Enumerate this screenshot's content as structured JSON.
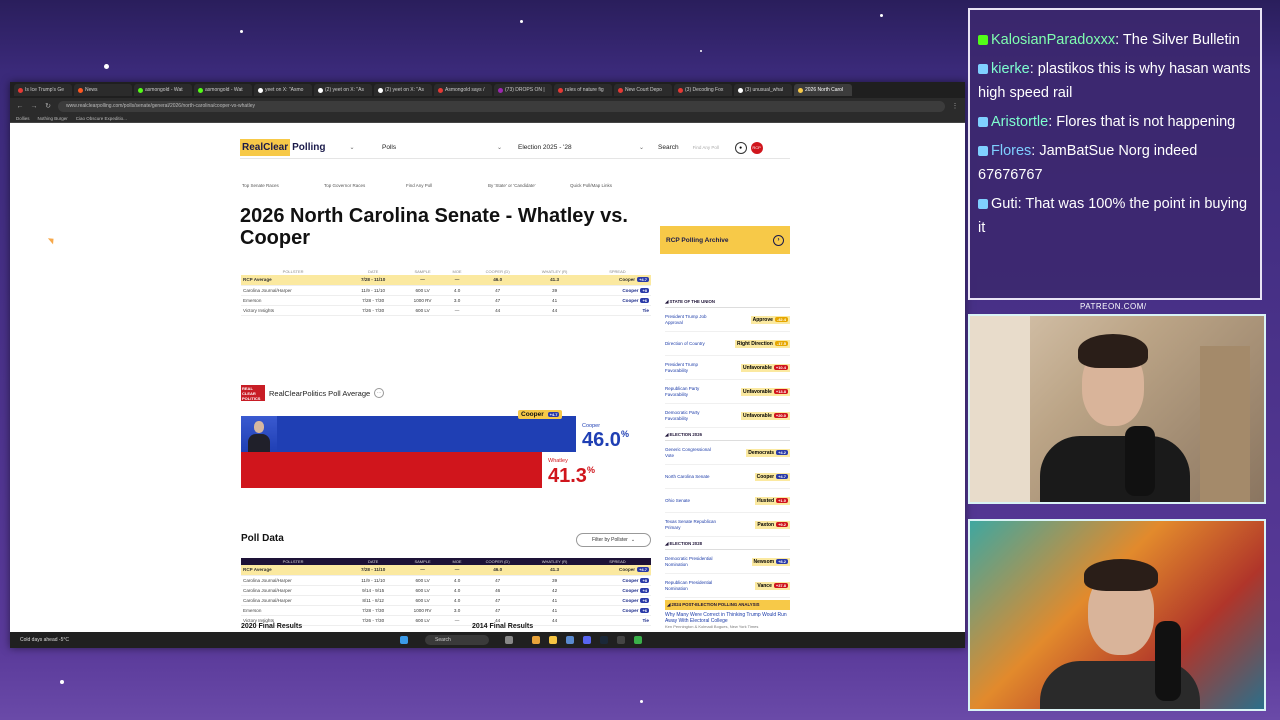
{
  "browser": {
    "tabs": [
      {
        "title": "Is Ice Trump's Ge",
        "color": "#e53935"
      },
      {
        "title": "News",
        "color": "#ff5722"
      },
      {
        "title": "asmongold - Wat",
        "color": "#53fc18"
      },
      {
        "title": "asmongold - Wat",
        "color": "#53fc18"
      },
      {
        "title": "yeet on X: \"Asmo",
        "color": "#ffffff"
      },
      {
        "title": "(2) yeet on X: \"As",
        "color": "#ffffff"
      },
      {
        "title": "(2) yeet on X: \"As",
        "color": "#ffffff"
      },
      {
        "title": "Asmongold says /",
        "color": "#e53935"
      },
      {
        "title": "(73) DROPS ON |",
        "color": "#9c27b0"
      },
      {
        "title": "rules of nature fig",
        "color": "#e53935"
      },
      {
        "title": "New Court Depo",
        "color": "#e53935"
      },
      {
        "title": "(3) Decoding Fox",
        "color": "#e53935"
      },
      {
        "title": "(3) unusual_whal",
        "color": "#ffffff"
      },
      {
        "title": "2026 North Carol",
        "color": "#f7c948"
      }
    ],
    "url": "www.realclearpolling.com/polls/senate/general/2026/north-carolina/cooper-vs-whatley",
    "bookmarks": [
      "Dollies",
      "Nothing Burger",
      "Ciao Obscure Expeditio..."
    ]
  },
  "header": {
    "logo_rc": "RealClear",
    "logo_polling": "Polling",
    "nav_polls": "Polls",
    "nav_election": "Election 2025 - '28",
    "search_label": "Search",
    "search_placeholder": "Find Any Poll",
    "badge": "RCP"
  },
  "subnav": [
    "Top Senate Races",
    "Top Governor Races",
    "Find Any Poll",
    "By 'State' or 'Candidate'",
    "Quick Poll/Map Links"
  ],
  "title": "2026 North Carolina Senate - Whatley vs. Cooper",
  "table_headers": [
    "POLLSTER",
    "DATE",
    "SAMPLE",
    "MOE",
    "COOPER (D)",
    "WHATLEY (R)",
    "SPREAD"
  ],
  "summary_rows": [
    {
      "pollster": "RCP Average",
      "date": "7/28 - 11/10",
      "sample": "—",
      "moe": "—",
      "cooper": "46.0",
      "whatley": "41.3",
      "spread": "Cooper",
      "margin": "+4.7",
      "avg": true
    },
    {
      "pollster": "Carolina Journal/Harper",
      "date": "11/9 - 11/10",
      "sample": "600 LV",
      "moe": "4.0",
      "cooper": "47",
      "whatley": "39",
      "spread": "Cooper",
      "margin": "+8"
    },
    {
      "pollster": "Emerson",
      "date": "7/28 - 7/30",
      "sample": "1000 RV",
      "moe": "3.0",
      "cooper": "47",
      "whatley": "41",
      "spread": "Cooper",
      "margin": "+6"
    },
    {
      "pollster": "Victory Insights",
      "date": "7/26 - 7/30",
      "sample": "600 LV",
      "moe": "—",
      "cooper": "44",
      "whatley": "44",
      "spread": "Tie",
      "margin": ""
    }
  ],
  "poll_average": {
    "title": "RealClearPolitics Poll Average",
    "logo": "REAL CLEAR POLITICS",
    "cooper_name": "Cooper",
    "cooper_pct": "46.0",
    "whatley_name": "Whatley",
    "whatley_pct": "41.3",
    "pct_sign": "%",
    "cooper_tag": "Cooper",
    "cooper_margin": "+4.7",
    "cooper_fraction": 0.46,
    "whatley_fraction": 0.413
  },
  "poll_data": {
    "title": "Poll Data",
    "filter_label": "Filter by Pollster",
    "rows": [
      {
        "pollster": "RCP Average",
        "date": "7/28 - 11/10",
        "sample": "—",
        "moe": "—",
        "cooper": "46.0",
        "whatley": "41.3",
        "spread": "Cooper",
        "margin": "+4.7",
        "avg": true
      },
      {
        "pollster": "Carolina Journal/Harper",
        "date": "11/9 - 11/10",
        "sample": "600 LV",
        "moe": "4.0",
        "cooper": "47",
        "whatley": "39",
        "spread": "Cooper",
        "margin": "+8"
      },
      {
        "pollster": "Carolina Journal/Harper",
        "date": "9/14 - 9/15",
        "sample": "600 LV",
        "moe": "4.0",
        "cooper": "46",
        "whatley": "42",
        "spread": "Cooper",
        "margin": "+4"
      },
      {
        "pollster": "Carolina Journal/Harper",
        "date": "8/11 - 8/12",
        "sample": "600 LV",
        "moe": "4.0",
        "cooper": "47",
        "whatley": "41",
        "spread": "Cooper",
        "margin": "+6"
      },
      {
        "pollster": "Emerson",
        "date": "7/28 - 7/30",
        "sample": "1000 RV",
        "moe": "3.0",
        "cooper": "47",
        "whatley": "41",
        "spread": "Cooper",
        "margin": "+6"
      },
      {
        "pollster": "Victory Insights",
        "date": "7/26 - 7/30",
        "sample": "600 LV",
        "moe": "—",
        "cooper": "44",
        "whatley": "44",
        "spread": "Tie",
        "margin": ""
      }
    ]
  },
  "final_results": [
    "2020 Final Results",
    "2014 Final Results"
  ],
  "sidebar": {
    "archive": "RCP Polling Archive",
    "sections": [
      {
        "title": "STATE OF THE UNION",
        "rows": [
          {
            "label": "President Trump Job Approval",
            "value": "Approve",
            "badge": "-42.4",
            "color": "#e6a700"
          },
          {
            "label": "Direction of Country",
            "value": "Right Direction",
            "badge": "-17.5",
            "color": "#e6a700"
          },
          {
            "label": "President Trump Favorability",
            "value": "Unfavorable",
            "badge": "+10.4",
            "color": "#d0151c"
          },
          {
            "label": "Republican Party Favorability",
            "value": "Unfavorable",
            "badge": "+13.8",
            "color": "#d0151c"
          },
          {
            "label": "Democratic Party Favorability",
            "value": "Unfavorable",
            "badge": "+20.0",
            "color": "#d0151c"
          }
        ]
      },
      {
        "title": "ELECTION 2026",
        "rows": [
          {
            "label": "Generic Congressional Vote",
            "value": "Democrats",
            "badge": "+4.2",
            "color": "#2a3aa8"
          },
          {
            "label": "North Carolina Senate",
            "value": "Cooper",
            "badge": "+4.7",
            "color": "#2a3aa8"
          },
          {
            "label": "Ohio Senate",
            "value": "Husted",
            "badge": "+1.0",
            "color": "#d0151c"
          },
          {
            "label": "Texas Senate Republican Primary",
            "value": "Paxton",
            "badge": "+9.2",
            "color": "#d0151c"
          }
        ]
      },
      {
        "title": "ELECTION 2028",
        "rows": [
          {
            "label": "Democratic Presidential Nomination",
            "value": "Newsom",
            "badge": "+8.2",
            "color": "#2a3aa8"
          },
          {
            "label": "Republican Presidential Nomination",
            "value": "Vance",
            "badge": "+37.8",
            "color": "#d0151c"
          }
        ]
      }
    ],
    "banner": "2024 POST-ELECTION POLLING ANALYSIS",
    "article": "Why Many Were Correct in Thinking Trump Would Run Away With Electoral College",
    "byline": "Ken Pennington & Kolmadi Bogues, New York Times"
  },
  "taskbar": {
    "weather": "Cold days ahead",
    "temp": "-5°C",
    "search": "Search"
  },
  "chat": [
    {
      "user": "",
      "text": "",
      "partial": true
    },
    {
      "user": "KalosianParadoxxx",
      "text": ": The Silver Bulletin",
      "color": "#7fffb0",
      "icon": "#53fc18"
    },
    {
      "user": "kierke",
      "text": ": plastikos this is why hasan wants high speed rail",
      "color": "#7fffd0",
      "icon": "#7fd0ff"
    },
    {
      "user": "Aristortle",
      "text": ": Flores that is not happening",
      "color": "#7fffd0",
      "icon": "#7fd0ff"
    },
    {
      "user": "Flores",
      "text": ": JamBatSue Norg indeed 67676767",
      "color": "#7fd0ff",
      "icon": "#7fd0ff"
    },
    {
      "user": "Guti",
      "text": ": That was 100% the point in buying it",
      "color": "#ffffff",
      "icon": "#7fd0ff"
    }
  ],
  "patreon": "PATREON.COM/"
}
